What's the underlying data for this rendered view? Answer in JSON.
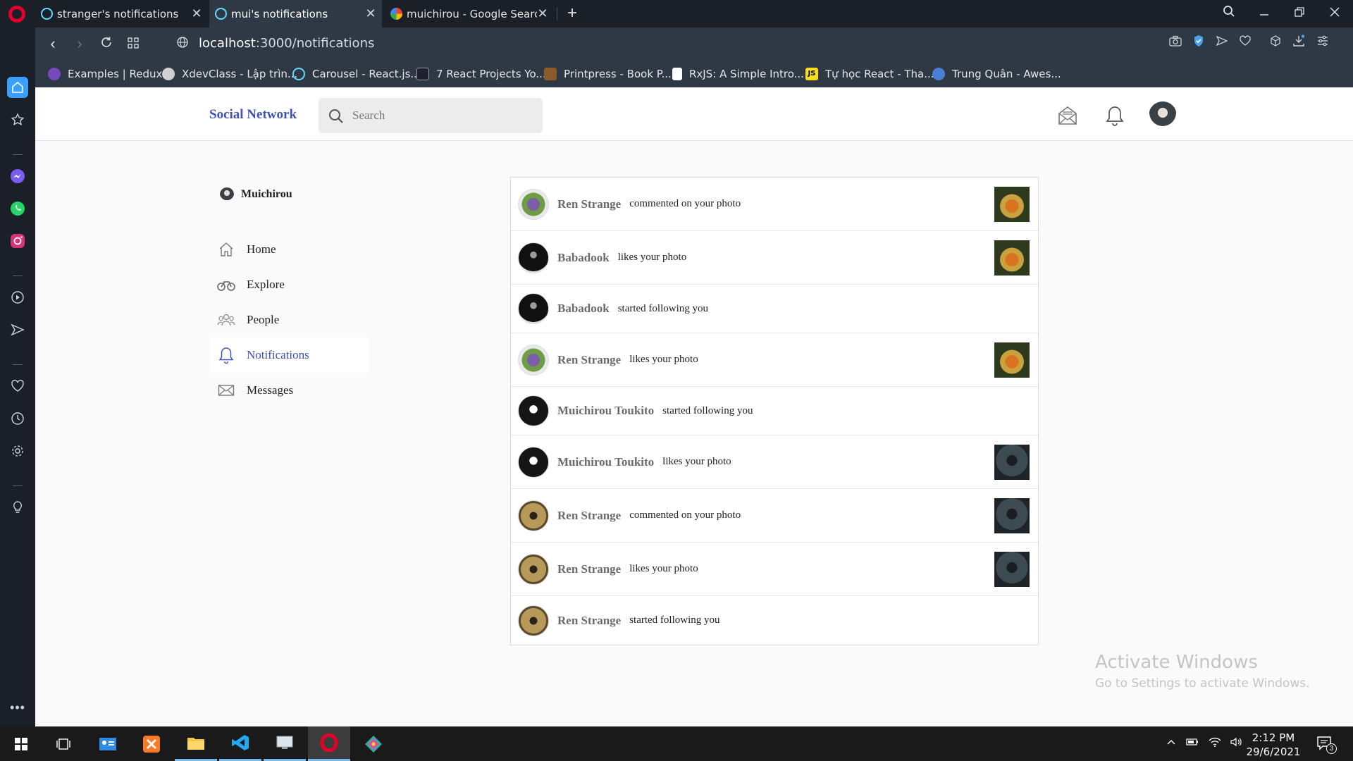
{
  "browser": {
    "tabs": [
      {
        "title": "stranger's notifications",
        "icon": "react-icon"
      },
      {
        "title": "mui's notifications",
        "icon": "react-icon"
      },
      {
        "title": "muichirou - Google Search",
        "icon": "google-icon"
      }
    ],
    "url_host": "localhost",
    "url_path": ":3000/notifications",
    "bookmarks": [
      {
        "label": "Examples | Redux",
        "color": "#764abc"
      },
      {
        "label": "XdevClass - Lập trìn...",
        "color": "#d0d0d0"
      },
      {
        "label": "Carousel - React.js...",
        "color": "#61dafb"
      },
      {
        "label": "7 React Projects Yo...",
        "color": "#1e1e2e"
      },
      {
        "label": "Printpress - Book P...",
        "color": "#8a5a2a"
      },
      {
        "label": "RxJS: A Simple Intro...",
        "color": "#ffffff"
      },
      {
        "label": "Tự học React - Tha...",
        "color": "#f7df1e"
      },
      {
        "label": "Trung Quân - Awes...",
        "color": "#4a7fd6"
      }
    ]
  },
  "header": {
    "brand": "Social Network",
    "search_placeholder": "Search"
  },
  "profile": {
    "name": "Muichirou"
  },
  "menu": [
    {
      "label": "Home",
      "icon": "home-icon"
    },
    {
      "label": "Explore",
      "icon": "bicycle-icon"
    },
    {
      "label": "People",
      "icon": "people-icon"
    },
    {
      "label": "Notifications",
      "icon": "bell-icon",
      "active": true
    },
    {
      "label": "Messages",
      "icon": "envelope-icon"
    }
  ],
  "notifications": [
    {
      "user": "Ren Strange",
      "action": "commented on your photo",
      "thumb": "food"
    },
    {
      "user": "Babadook",
      "action": "likes your photo",
      "thumb": "food"
    },
    {
      "user": "Babadook",
      "action": "started following you",
      "thumb": null
    },
    {
      "user": "Ren Strange",
      "action": "likes your photo",
      "thumb": "food"
    },
    {
      "user": "Muichirou Toukito",
      "action": "started following you",
      "thumb": null
    },
    {
      "user": "Muichirou Toukito",
      "action": "likes your photo",
      "thumb": "dark"
    },
    {
      "user": "Ren Strange",
      "action": "commented on your photo",
      "thumb": "dark"
    },
    {
      "user": "Ren Strange",
      "action": "likes your photo",
      "thumb": "dark"
    },
    {
      "user": "Ren Strange",
      "action": "started following you",
      "thumb": null
    }
  ],
  "watermark": {
    "title": "Activate Windows",
    "subtitle": "Go to Settings to activate Windows."
  },
  "taskbar": {
    "time": "2:12 PM",
    "date": "29/6/2021",
    "notification_count": "3"
  },
  "colors": {
    "accent": "#3f51b5",
    "chrome_dark": "#1b1f27",
    "chrome": "#2f3845",
    "opera_red": "#e4002b"
  }
}
